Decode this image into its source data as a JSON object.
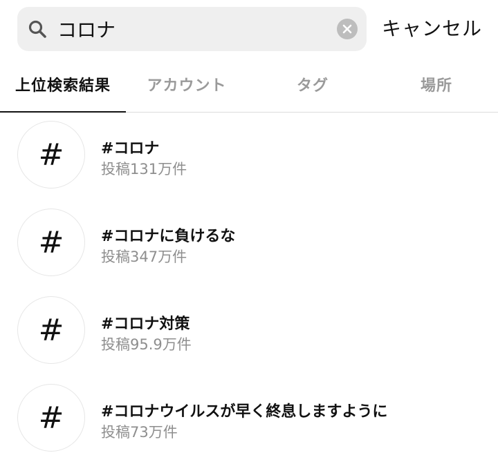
{
  "search": {
    "query": "コロナ",
    "cancel_label": "キャンセル"
  },
  "tabs": [
    {
      "label": "上位検索結果",
      "active": true
    },
    {
      "label": "アカウント",
      "active": false
    },
    {
      "label": "タグ",
      "active": false
    },
    {
      "label": "場所",
      "active": false
    }
  ],
  "results": [
    {
      "icon": "#",
      "title": "#コロナ",
      "subtitle": "投稿131万件"
    },
    {
      "icon": "#",
      "title": "#コロナに負けるな",
      "subtitle": "投稿347万件"
    },
    {
      "icon": "#",
      "title": "#コロナ対策",
      "subtitle": "投稿95.9万件"
    },
    {
      "icon": "#",
      "title": "#コロナウイルスが早く終息しますように",
      "subtitle": "投稿73万件"
    }
  ],
  "colors": {
    "search_bg": "#efefef",
    "inactive_tab": "#9a9a9a",
    "secondary_text": "#8e8e8e"
  }
}
